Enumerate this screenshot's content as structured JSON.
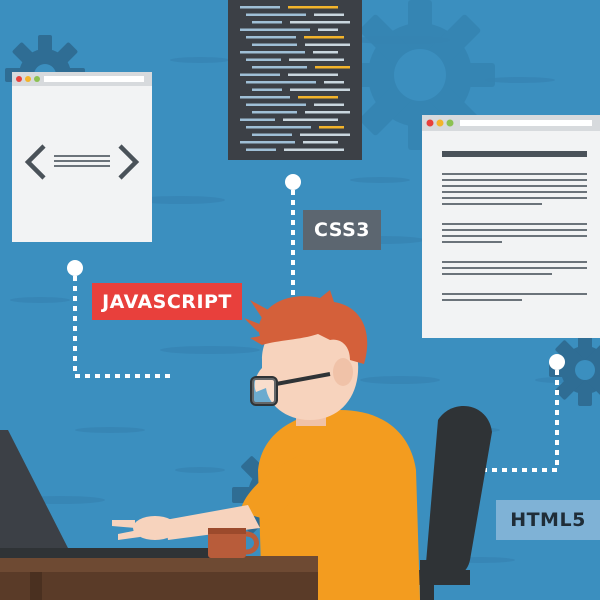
{
  "labels": {
    "javascript": "JAVASCRIPT",
    "css3": "CSS3",
    "html5": "HTML5"
  },
  "colors": {
    "background": "#3b8fbf",
    "javascript_tag": "#e8403c",
    "css3_tag": "#5c6670",
    "html5_tag": "#7fb2d6",
    "shirt": "#f39c1f",
    "hair": "#d4603a",
    "skin": "#f7d3bd",
    "desk": "#6e4a33",
    "chair": "#2f3336",
    "code_panel": "#3c4046"
  },
  "icons": [
    "gear-icon",
    "code-brackets-icon",
    "coffee-mug-icon",
    "laptop-icon"
  ]
}
